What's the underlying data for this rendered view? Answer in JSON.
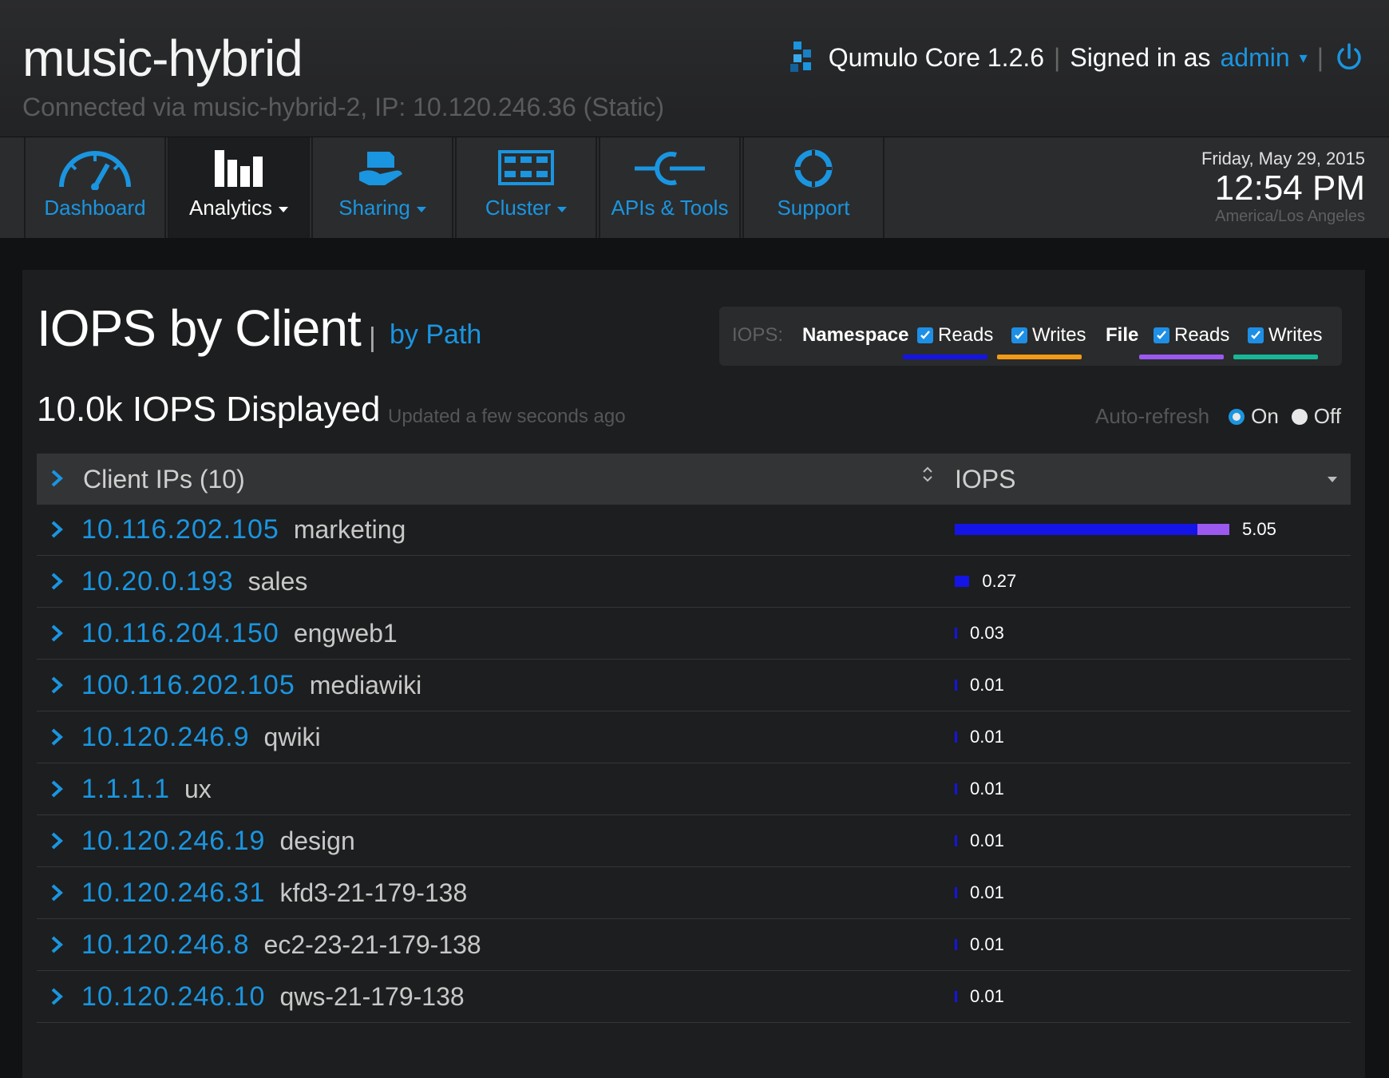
{
  "header": {
    "cluster_name": "music-hybrid",
    "connection": "Connected via music-hybrid-2, IP: 10.120.246.36 (Static)",
    "product": "Qumulo Core 1.2.6",
    "signed_in_label": "Signed in as",
    "user": "admin"
  },
  "nav": {
    "tabs": [
      {
        "label": "Dashboard",
        "icon": "gauge-icon",
        "dropdown": false,
        "active": false
      },
      {
        "label": "Analytics",
        "icon": "bar-chart-icon",
        "dropdown": true,
        "active": true
      },
      {
        "label": "Sharing",
        "icon": "hand-share-icon",
        "dropdown": true,
        "active": false
      },
      {
        "label": "Cluster",
        "icon": "server-grid-icon",
        "dropdown": true,
        "active": false
      },
      {
        "label": "APIs & Tools",
        "icon": "plug-icon",
        "dropdown": false,
        "active": false
      },
      {
        "label": "Support",
        "icon": "lifebuoy-icon",
        "dropdown": false,
        "active": false
      }
    ]
  },
  "clock": {
    "date": "Friday, May 29, 2015",
    "time": "12:54 PM",
    "timezone": "America/Los Angeles"
  },
  "page": {
    "title": "IOPS by Client",
    "separator": "|",
    "alt_view": "by Path",
    "summary": "10.0k IOPS Displayed",
    "updated": "Updated a few seconds ago"
  },
  "legend": {
    "prefix": "IOPS:",
    "namespace_label": "Namespace",
    "file_label": "File",
    "reads_label": "Reads",
    "writes_label": "Writes",
    "colors": {
      "namespace_reads": "#1414e6",
      "namespace_writes": "#f29a16",
      "file_reads": "#9b59f0",
      "file_writes": "#17b897"
    },
    "checked": {
      "namespace_reads": true,
      "namespace_writes": true,
      "file_reads": true,
      "file_writes": true
    }
  },
  "auto_refresh": {
    "label": "Auto-refresh",
    "on_label": "On",
    "off_label": "Off",
    "selected": "On"
  },
  "table": {
    "col_client": "Client IPs (10)",
    "col_iops": "IOPS",
    "rows": [
      {
        "ip": "10.116.202.105",
        "host": "marketing",
        "value": "5.05",
        "ns_reads": 4.46,
        "file_reads": 0.59
      },
      {
        "ip": "10.20.0.193",
        "host": "sales",
        "value": "0.27",
        "ns_reads": 0.27,
        "file_reads": 0
      },
      {
        "ip": "10.116.204.150",
        "host": "engweb1",
        "value": "0.03",
        "ns_reads": 0.03,
        "file_reads": 0
      },
      {
        "ip": "100.116.202.105",
        "host": "mediawiki",
        "value": "0.01",
        "ns_reads": 0.01,
        "file_reads": 0
      },
      {
        "ip": "10.120.246.9",
        "host": "qwiki",
        "value": "0.01",
        "ns_reads": 0.01,
        "file_reads": 0
      },
      {
        "ip": "1.1.1.1",
        "host": "ux",
        "value": "0.01",
        "ns_reads": 0.01,
        "file_reads": 0
      },
      {
        "ip": "10.120.246.19",
        "host": "design",
        "value": "0.01",
        "ns_reads": 0.01,
        "file_reads": 0
      },
      {
        "ip": "10.120.246.31",
        "host": "kfd3-21-179-138",
        "value": "0.01",
        "ns_reads": 0.01,
        "file_reads": 0
      },
      {
        "ip": "10.120.246.8",
        "host": "ec2-23-21-179-138",
        "value": "0.01",
        "ns_reads": 0.01,
        "file_reads": 0
      },
      {
        "ip": "10.120.246.10",
        "host": "qws-21-179-138",
        "value": "0.01",
        "ns_reads": 0.01,
        "file_reads": 0
      }
    ]
  }
}
